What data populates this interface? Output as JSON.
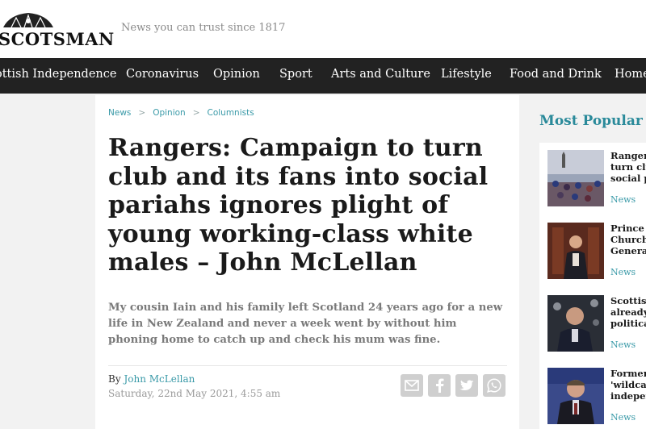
{
  "site": {
    "logo_text": "SCOTSMAN",
    "tagline": "News you can trust since 1817"
  },
  "nav": {
    "items": [
      "ottish Independence",
      "Coronavirus",
      "Opinion",
      "Sport",
      "Arts and Culture",
      "Lifestyle",
      "Food and Drink",
      "Home"
    ]
  },
  "article": {
    "breadcrumb": [
      "News",
      "Opinion",
      "Columnists"
    ],
    "breadcrumb_separator": ">",
    "headline": "Rangers: Campaign to turn club and its fans into social pariahs ignores plight of young working-class white males – John McLellan",
    "standfirst": "My cousin Iain and his family left Scotland 24 years ago for a new life in New Zealand and never a week went by without him phoning home to catch up and check his mum was fine.",
    "byline_prefix": "By",
    "author": "John McLellan",
    "date": "Saturday, 22nd May 2021, 4:55 am",
    "share_icons": [
      "email-icon",
      "facebook-icon",
      "twitter-icon",
      "whatsapp-icon"
    ]
  },
  "most_popular": {
    "title": "Most Popular",
    "items": [
      {
        "lines": [
          "Rangers",
          "turn clu",
          "social p"
        ],
        "tag": "News"
      },
      {
        "lines": [
          "Prince W",
          "Church",
          "General"
        ],
        "tag": "News"
      },
      {
        "lines": [
          "Scottish",
          "already",
          "politica"
        ],
        "tag": "News"
      },
      {
        "lines": [
          "Former",
          "'wildcat",
          "indeper"
        ],
        "tag": "News"
      }
    ]
  },
  "colors": {
    "nav_bg": "#222222",
    "accent": "#3a9aa8",
    "page_bg": "#f2f2f2"
  }
}
